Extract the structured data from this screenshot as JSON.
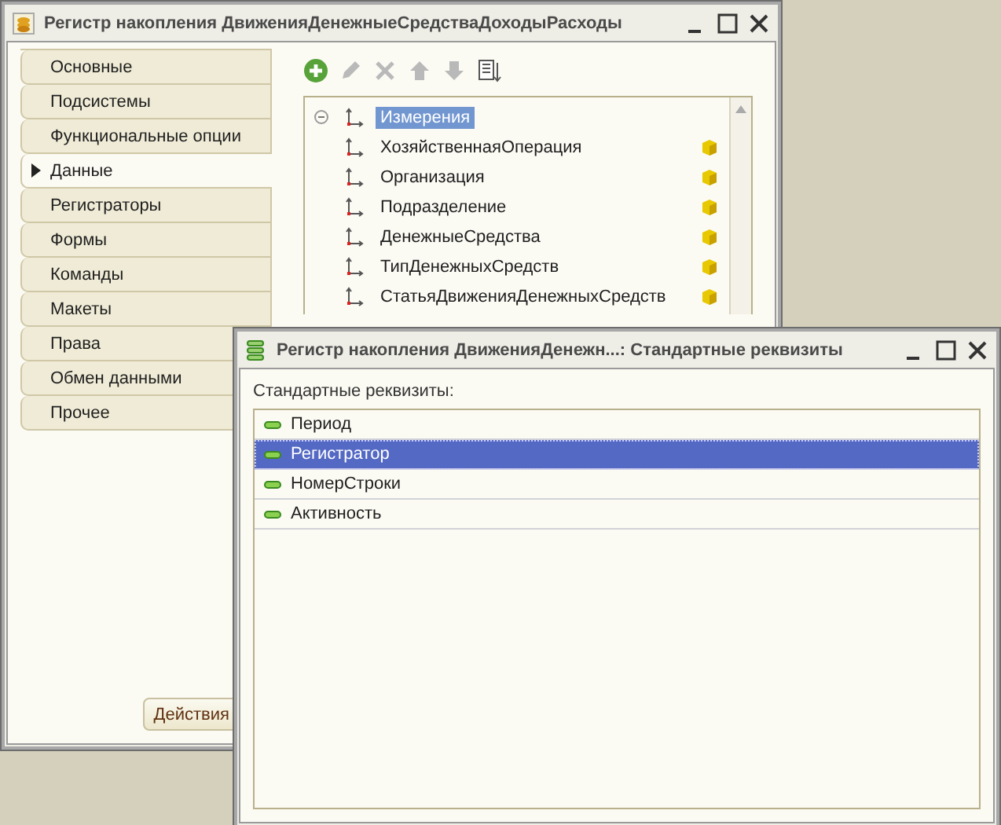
{
  "back_window": {
    "title": "Регистр накопления ДвиженияДенежныеСредстваДоходыРасходы",
    "sections": [
      {
        "label": "Основные",
        "selected": false
      },
      {
        "label": "Подсистемы",
        "selected": false
      },
      {
        "label": "Функциональные опции",
        "selected": false
      },
      {
        "label": "Данные",
        "selected": true
      },
      {
        "label": "Регистраторы",
        "selected": false
      },
      {
        "label": "Формы",
        "selected": false
      },
      {
        "label": "Команды",
        "selected": false
      },
      {
        "label": "Макеты",
        "selected": false
      },
      {
        "label": "Права",
        "selected": false
      },
      {
        "label": "Обмен данными",
        "selected": false
      },
      {
        "label": "Прочее",
        "selected": false
      }
    ],
    "toolbar": [
      {
        "kind": "add",
        "disabled": false
      },
      {
        "kind": "edit",
        "disabled": true
      },
      {
        "kind": "delete",
        "disabled": true
      },
      {
        "kind": "up",
        "disabled": true
      },
      {
        "kind": "down",
        "disabled": true
      },
      {
        "kind": "sort",
        "disabled": false
      }
    ],
    "tree": {
      "label": "Измерения",
      "expanded": true,
      "selected": true,
      "children": [
        {
          "label": "ХозяйственнаяОперация"
        },
        {
          "label": "Организация"
        },
        {
          "label": "Подразделение"
        },
        {
          "label": "ДенежныеСредства"
        },
        {
          "label": "ТипДенежныхСредств"
        },
        {
          "label": "СтатьяДвиженияДенежныхСредств"
        }
      ]
    },
    "actions_button": "Действия"
  },
  "front_window": {
    "title": "Регистр накопления ДвиженияДенежн...: Стандартные реквизиты",
    "caption": "Стандартные реквизиты:",
    "items": [
      {
        "label": "Период",
        "selected": false
      },
      {
        "label": "Регистратор",
        "selected": true
      },
      {
        "label": "НомерСтроки",
        "selected": false
      },
      {
        "label": "Активность",
        "selected": false
      }
    ]
  }
}
